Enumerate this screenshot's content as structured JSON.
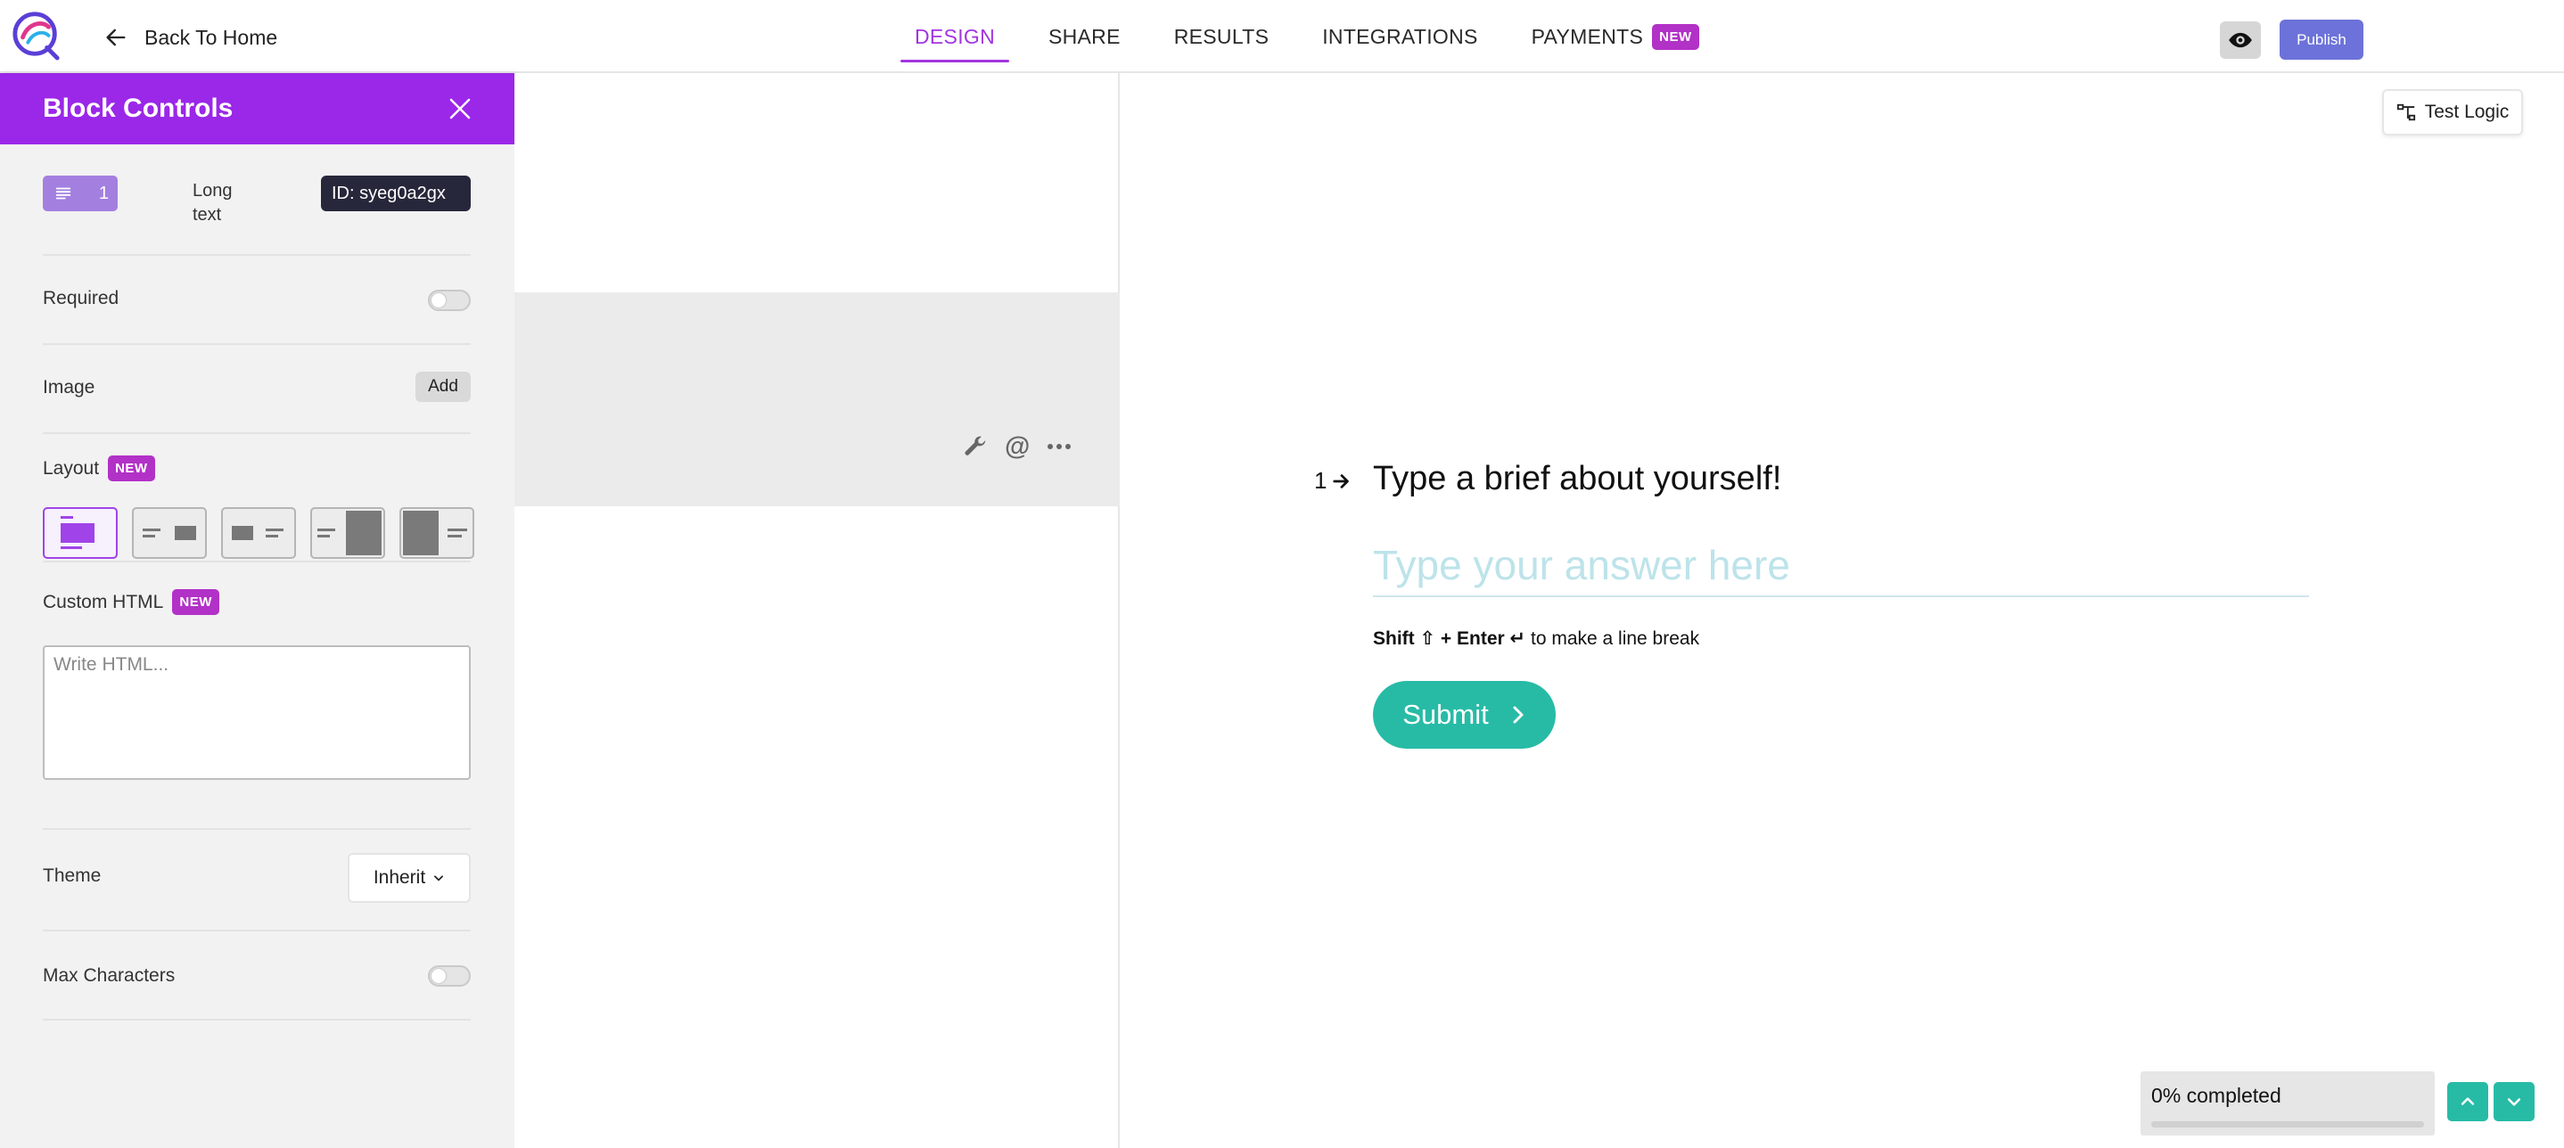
{
  "topbar": {
    "back_label": "Back To Home",
    "tabs": [
      {
        "label": "DESIGN",
        "active": true
      },
      {
        "label": "SHARE",
        "active": false
      },
      {
        "label": "RESULTS",
        "active": false
      },
      {
        "label": "INTEGRATIONS",
        "active": false
      },
      {
        "label": "PAYMENTS",
        "active": false,
        "badge": "NEW"
      }
    ],
    "publish_label": "Publish",
    "accent_color": "#a235e0",
    "publish_color": "#6c72d9"
  },
  "panel": {
    "title": "Block Controls",
    "header_color": "#9b27e8",
    "block_number": "1",
    "block_type": "Long text",
    "block_id": "ID: syeg0a2gx",
    "required_label": "Required",
    "required_on": false,
    "image_label": "Image",
    "image_add_label": "Add",
    "layout_label": "Layout",
    "layout_badge": "NEW",
    "layout_selected": 0,
    "custom_html_label": "Custom HTML",
    "custom_html_badge": "NEW",
    "custom_html_placeholder": "Write HTML...",
    "theme_label": "Theme",
    "theme_value": "Inherit",
    "max_chars_label": "Max Characters",
    "max_chars_on": false
  },
  "preview": {
    "test_logic_label": "Test Logic",
    "question_number": "1",
    "question_title": "Type a brief about yourself!",
    "answer_placeholder": "Type your answer here",
    "hint_shift": "Shift ⇧ + Enter ↵",
    "hint_rest": "to make a line break",
    "submit_label": "Submit",
    "progress_label": "0% completed",
    "progress_fraction": 0,
    "button_color": "#27bba6"
  },
  "icons": {
    "logo": "brand-logo-icon",
    "back": "arrow-left-icon",
    "eye": "eye-icon",
    "close": "close-icon",
    "type": "long-text-lines-icon",
    "wrench": "wrench-icon",
    "at": "at-icon",
    "more": "more-horizontal-icon",
    "logic": "logic-flow-icon",
    "question_arrow": "arrow-right-icon",
    "submit_chevron": "chevron-right-icon",
    "up": "chevron-up-icon",
    "down": "chevron-down-icon"
  }
}
